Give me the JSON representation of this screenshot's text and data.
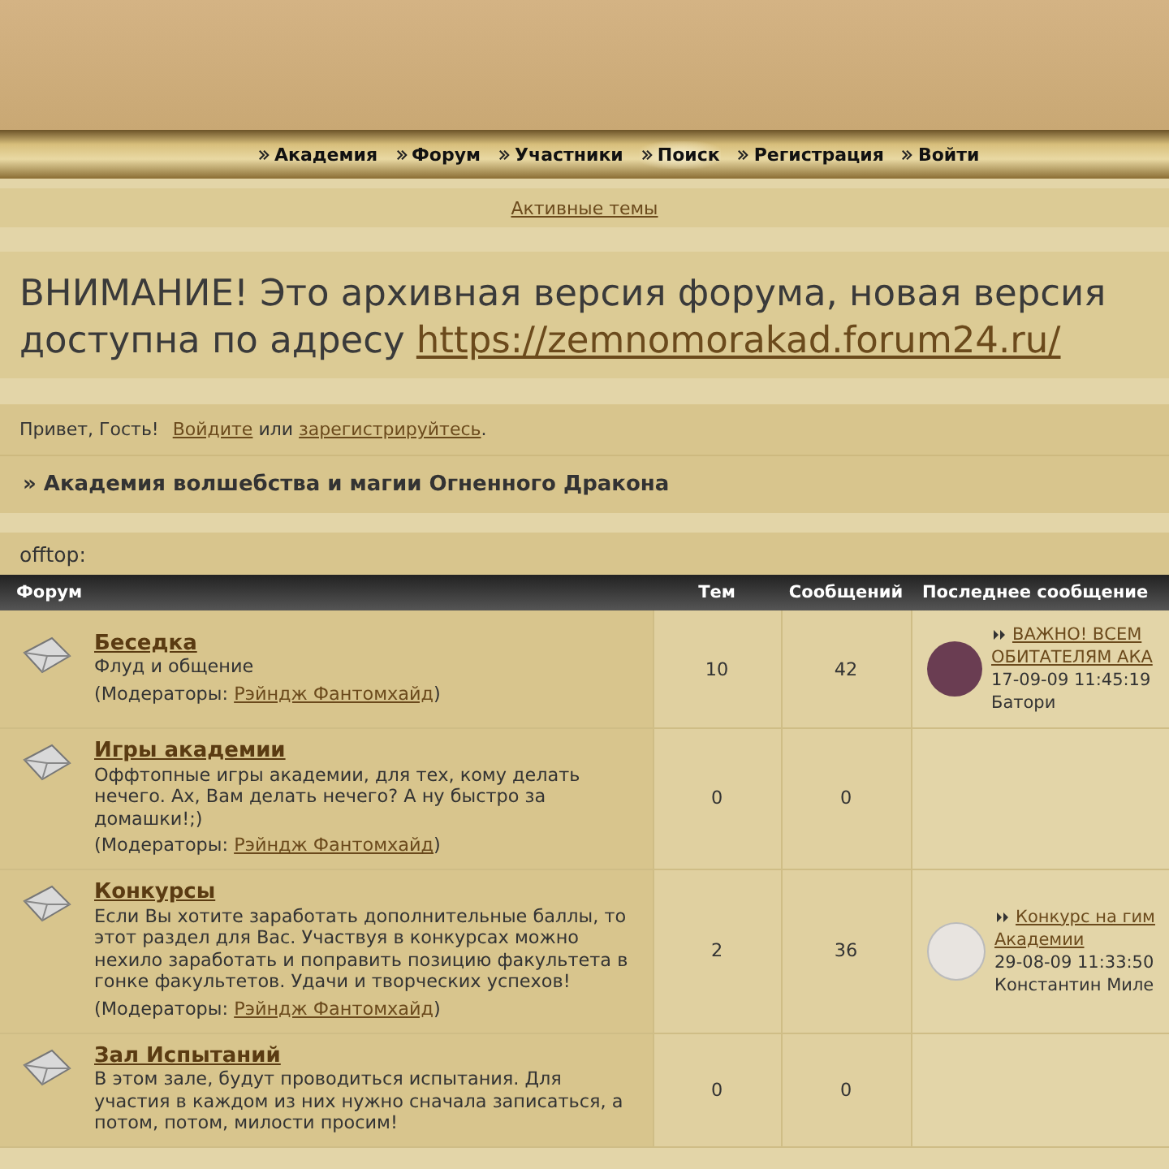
{
  "nav": [
    {
      "label": "Академия",
      "selected": false
    },
    {
      "label": "Форум",
      "selected": false
    },
    {
      "label": "Участники",
      "selected": false
    },
    {
      "label": "Поиск",
      "selected": true
    },
    {
      "label": "Регистрация",
      "selected": false
    },
    {
      "label": "Войти",
      "selected": false
    }
  ],
  "active_topics": "Активные темы",
  "notice": {
    "text": "ВНИМАНИЕ! Это архивная версия форума, новая версия доступна по адресу",
    "link": "https://zemnomorakad.forum24.ru/"
  },
  "greeting": {
    "hello": "Привет, Гость!",
    "login": "Войдите",
    "or": "или",
    "register": "зарегистрируйтесь",
    "end": "."
  },
  "breadcrumb": "» Академия волшебства и магии Огненного Дракона",
  "category": "offtop:",
  "columns": [
    "Форум",
    "Тем",
    "Сообщений",
    "Последнее сообщение"
  ],
  "rows": [
    {
      "title": "Беседка",
      "description": "Флуд и общение",
      "moderators_label": "(Модераторы:",
      "moderator": "Рэйндж Фантомхайд",
      "close": ")",
      "topics": "10",
      "posts": "42",
      "last_post": {
        "title_lines": [
          "ВАЖНО! ВСЕМ",
          "ОБИТАТЕЛЯМ АКА"
        ],
        "date": "17-09-09 11:45:19",
        "author": "Батори"
      }
    },
    {
      "title": "Игры академии",
      "description": "Оффтопные игры академии, для тех, кому делать нечего. Ах, Вам делать нечего? А ну быстро за домашки!;)",
      "moderators_label": "(Модераторы:",
      "moderator": "Рэйндж Фантомхайд",
      "close": ")",
      "topics": "0",
      "posts": "0"
    },
    {
      "title": "Конкурсы",
      "description": "Если Вы хотите заработать дополнительные баллы, то этот раздел для Вас. Участвуя в конкурсах можно нехило заработать и поправить позицию факультета в гонке факультетов. Удачи и творческих успехов!",
      "moderators_label": "(Модераторы:",
      "moderator": "Рэйндж Фантомхайд",
      "close": ")",
      "topics": "2",
      "posts": "36",
      "last_post": {
        "title_lines": [
          "Конкурс на гим",
          "Академии"
        ],
        "date": "29-08-09 11:33:50",
        "author": "Константин Миле"
      }
    },
    {
      "title": "Зал Испытаний",
      "description": "В этом зале, будут проводиться испытания. Для участия в каждом из них нужно сначала записаться, а потом, потом, милости просим!",
      "topics": "0",
      "posts": "0"
    }
  ]
}
